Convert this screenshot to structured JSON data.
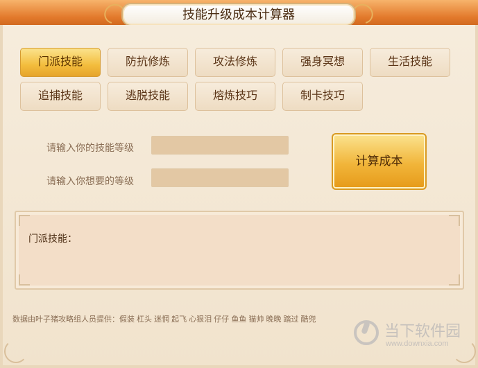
{
  "app": {
    "title": "技能升级成本计算器"
  },
  "tabs": [
    {
      "label": "门派技能",
      "active": true
    },
    {
      "label": "防抗修炼",
      "active": false
    },
    {
      "label": "攻法修炼",
      "active": false
    },
    {
      "label": "强身冥想",
      "active": false
    },
    {
      "label": "生活技能",
      "active": false
    },
    {
      "label": "追捕技能",
      "active": false
    },
    {
      "label": "逃脱技能",
      "active": false
    },
    {
      "label": "熔炼技巧",
      "active": false
    },
    {
      "label": "制卡技巧",
      "active": false
    }
  ],
  "form": {
    "current_level_label": "请输入你的技能等级",
    "current_level_value": "",
    "target_level_label": "请输入你想要的等级",
    "target_level_value": "",
    "calculate_label": "计算成本"
  },
  "result": {
    "label": "门派技能："
  },
  "credits": "数据由叶子猪攻略组人员提供：假装 杠头 迷惘 起飞 心狠泪 仔仔 鱼鱼 猫帅 晚晚 踏过 酷兜",
  "watermark": {
    "title": "当下软件园",
    "url": "www.downxia.com"
  },
  "colors": {
    "accent_active": "#f3bd3d",
    "banner": "#e2792b",
    "input_bg": "#e3c8a4",
    "text_dark": "#4a2c12",
    "text_muted": "#8a6e55"
  }
}
